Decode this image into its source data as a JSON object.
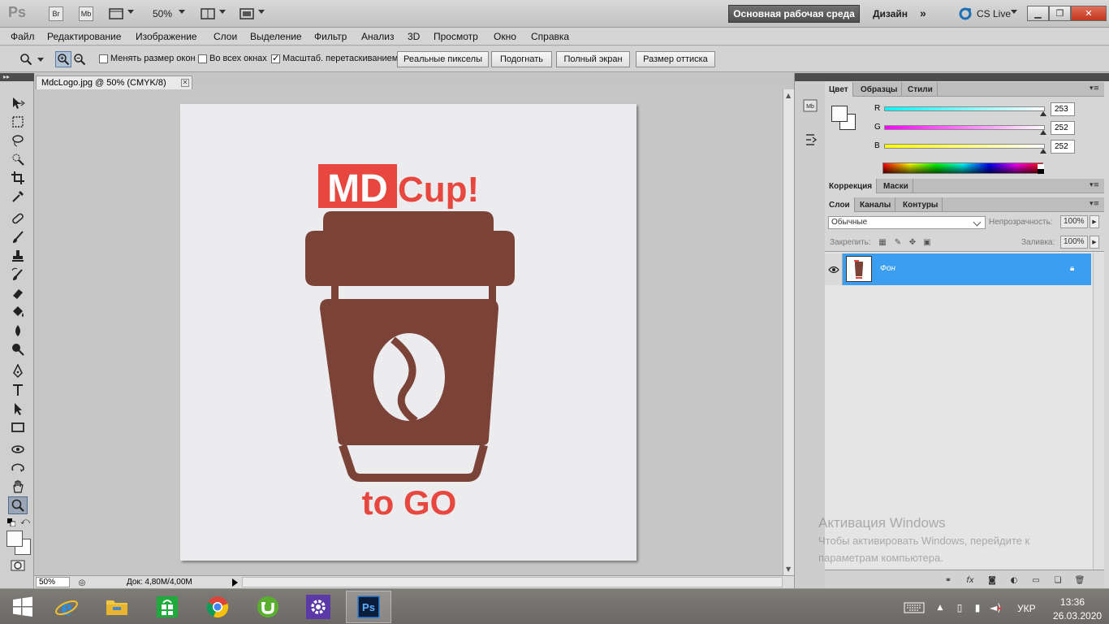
{
  "appbar": {
    "logo": "Ps",
    "bridge": "Br",
    "minibridge": "Mb",
    "zoom": "50%",
    "workspace": "Основная рабочая среда",
    "design": "Дизайн",
    "cslive": "CS Live"
  },
  "menu": [
    "Файл",
    "Редактирование",
    "Изображение",
    "Слои",
    "Выделение",
    "Фильтр",
    "Анализ",
    "3D",
    "Просмотр",
    "Окно",
    "Справка"
  ],
  "options": {
    "resize_windows": "Менять размер окон",
    "all_windows": "Во всех окнах",
    "scrubby_zoom": "Масштаб. перетаскиванием",
    "actual_pixels": "Реальные пикселы",
    "fit_screen": "Подогнать",
    "fill_screen": "Полный экран",
    "print_size": "Размер оттиска"
  },
  "document": {
    "tab_title": "MdcLogo.jpg @ 50% (CMYK/8)",
    "zoom": "50%",
    "doc_info": "Док: 4,80M/4,00M"
  },
  "logo": {
    "md": "MD",
    "cup": "Cup!",
    "togo": "to GO",
    "colors": {
      "brand_red": "#e8473f",
      "cup_brown": "#7b4237",
      "bg": "#ecebed"
    }
  },
  "color_panel": {
    "tabs": [
      "Цвет",
      "Образцы",
      "Стили"
    ],
    "channels": [
      {
        "label": "R",
        "value": "253",
        "level": 0.992
      },
      {
        "label": "G",
        "value": "252",
        "level": 0.988
      },
      {
        "label": "B",
        "value": "252",
        "level": 0.988
      }
    ]
  },
  "adjust_panel": {
    "tabs": [
      "Коррекция",
      "Маски"
    ]
  },
  "layers_panel": {
    "tabs": [
      "Слои",
      "Каналы",
      "Контуры"
    ],
    "blend_mode": "Обычные",
    "opacity_label": "Непрозрачность:",
    "opacity": "100%",
    "lock_label": "Закрепить:",
    "fill_label": "Заливка:",
    "fill": "100%",
    "layers": [
      {
        "name": "Фон"
      }
    ]
  },
  "watermark": {
    "title": "Активация Windows",
    "line1": "Чтобы активировать Windows, перейдите к",
    "line2": "параметрам компьютера."
  },
  "taskbar": {
    "lang": "УКР",
    "time": "13:36",
    "date": "26.03.2020"
  }
}
